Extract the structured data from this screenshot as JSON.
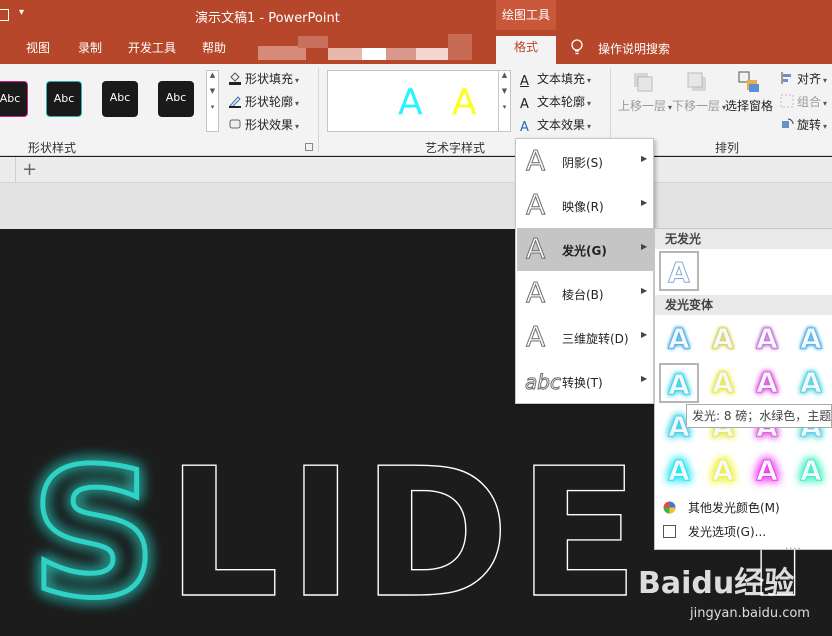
{
  "titlebar": {
    "title": "演示文稿1  -  PowerPoint",
    "context_group": "绘图工具"
  },
  "tabs": [
    {
      "label": "视图"
    },
    {
      "label": "录制"
    },
    {
      "label": "开发工具"
    },
    {
      "label": "帮助"
    },
    {
      "label": "格式",
      "active": true
    }
  ],
  "tell_me": "操作说明搜索",
  "ribbon": {
    "shape_styles": {
      "label": "形状样式",
      "swatches": [
        "Abc",
        "Abc",
        "Abc",
        "Abc"
      ],
      "fill": "形状填充",
      "outline": "形状轮廓",
      "effects": "形状效果"
    },
    "wordart_styles": {
      "label": "艺术字样式",
      "letters": [
        "A",
        "A"
      ],
      "text_fill": "文本填充",
      "text_outline": "文本轮廓",
      "text_effects": "文本效果"
    },
    "arrange": {
      "label": "排列",
      "bring_forward": "上移一层",
      "send_backward": "下移一层",
      "selection_pane": "选择窗格",
      "align": "对齐",
      "group": "组合",
      "rotate": "旋转"
    }
  },
  "effects_menu": [
    {
      "label": "阴影(S)"
    },
    {
      "label": "映像(R)"
    },
    {
      "label": "发光(G)",
      "active": true
    },
    {
      "label": "棱台(B)"
    },
    {
      "label": "三维旋转(D)"
    },
    {
      "label": "转换(T)"
    }
  ],
  "glow_submenu": {
    "no_glow_header": "无发光",
    "variants_header": "发光变体",
    "cell_letter": "A",
    "rows": [
      [
        "#5ab3e6",
        "#d8d66a",
        "#c77ad8",
        "#5ab3e6"
      ],
      [
        "#44d4e8",
        "#e8e85a",
        "#e060e0",
        "#5ad4e0"
      ],
      [
        "#44d4e8",
        "#e8e85a",
        "#e060e0",
        "#5ad4e0"
      ],
      [
        "#22e6f0",
        "#f0f040",
        "#f040f0",
        "#40f0c0"
      ]
    ],
    "tooltip": "发光: 8 磅；水绿色，主题色",
    "more_colors": "其他发光颜色(M)",
    "options": "发光选项(G)..."
  },
  "slide": {
    "text": "SLIDE T"
  },
  "watermark": {
    "brand": "Baidu经验",
    "url": "jingyan.baidu.com"
  },
  "colors": {
    "accent": "#b7472a",
    "glow": "#2fd3c6"
  }
}
